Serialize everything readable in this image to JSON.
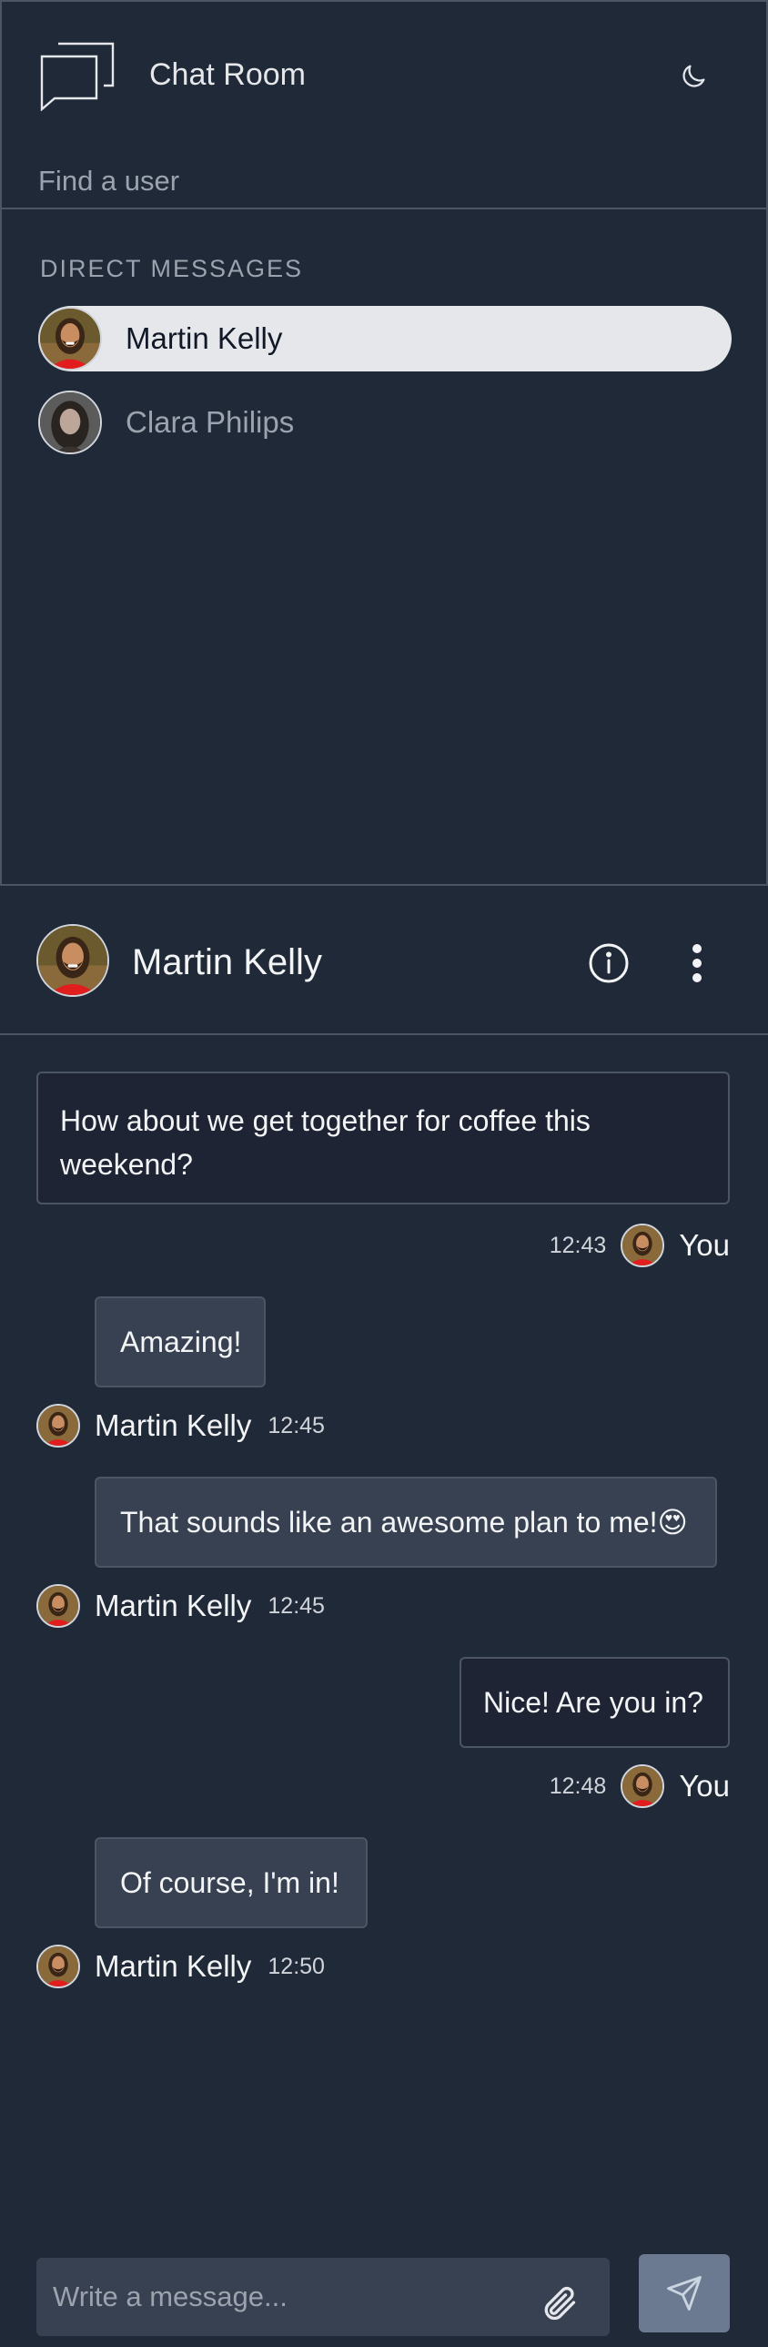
{
  "app": {
    "title": "Chat Room",
    "logo_icon": "chat-bubbles-icon",
    "theme_icon": "moon-icon"
  },
  "sidebar": {
    "search_placeholder": "Find a user",
    "section_heading": "DIRECT MESSAGES",
    "users": [
      {
        "name": "Martin Kelly",
        "active": true,
        "avatar": "avatar-martin"
      },
      {
        "name": "Clara Philips",
        "active": false,
        "avatar": "avatar-clara"
      }
    ]
  },
  "chat": {
    "contact_name": "Martin Kelly",
    "info_icon": "info-icon",
    "more_icon": "more-vertical-icon",
    "messages": [
      {
        "author": "You",
        "text": "How about we get together for coffee this weekend?",
        "time": "12:43",
        "mine": true
      },
      {
        "author": "Martin Kelly",
        "text": "Amazing!",
        "time": "12:45",
        "mine": false
      },
      {
        "author": "Martin Kelly",
        "text": "That sounds like an awesome plan to me!😍",
        "time": "12:45",
        "mine": false
      },
      {
        "author": "You",
        "text": "Nice! Are you in?",
        "time": "12:48",
        "mine": true
      },
      {
        "author": "Martin Kelly",
        "text": "Of course, I'm in!",
        "time": "12:50",
        "mine": false
      }
    ]
  },
  "composer": {
    "placeholder": "Write a message...",
    "attach_icon": "paperclip-icon",
    "send_icon": "send-icon"
  },
  "colors": {
    "background": "#1f2937",
    "border": "#4b5563",
    "active_item": "#e5e7eb",
    "their_bubble": "#374151",
    "send_button": "#6b7a90"
  }
}
